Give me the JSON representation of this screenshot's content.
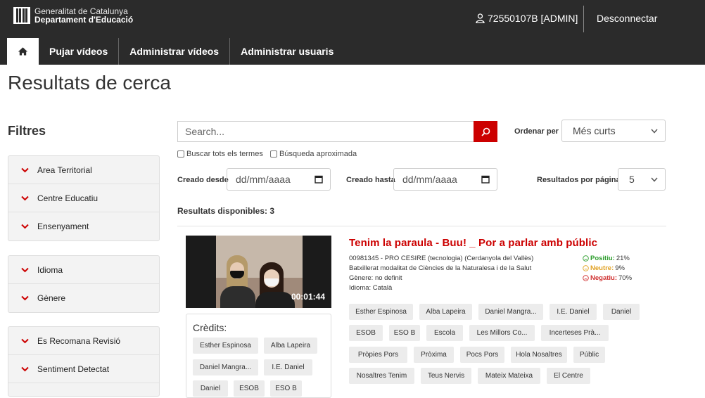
{
  "header": {
    "org_line1": "Generalitat de Catalunya",
    "org_line2": "Departament d'Educació",
    "user": "72550107B [ADMIN]",
    "logout": "Desconnectar",
    "nav": [
      "Pujar vídeos",
      "Administrar vídeos",
      "Administrar usuaris"
    ]
  },
  "page": {
    "title": "Resultats de cerca"
  },
  "filters": {
    "title": "Filtres",
    "group1": [
      "Area Territorial",
      "Centre Educatiu",
      "Ensenyament"
    ],
    "group2": [
      "Idioma",
      "Gènere"
    ],
    "group3": [
      "Es Recomana Revisió",
      "Sentiment Detectat"
    ]
  },
  "search": {
    "placeholder": "Search...",
    "all_terms": "Buscar tots els termes",
    "approx": "Búsqueda aproximada",
    "order_label": "Ordenar per",
    "order_value": "Més curts",
    "from_label": "Creado desde",
    "from_placeholder": "dd/mm/aaaa",
    "to_label": "Creado hasta",
    "to_placeholder": "dd/mm/aaaa",
    "per_page_label": "Resultados por página:",
    "per_page_value": "5",
    "available": "Resultats disponibles: 3"
  },
  "result": {
    "title": "Tenim la paraula - Buu! _ Por a parlar amb públic",
    "duration": "00:01:44",
    "center": "00981345 - PRO CESIRE (tecnologia) (Cerdanyola del Vallès)",
    "course": "Batxillerat modalitat de Ciències de la Naturalesa i de la Salut",
    "genre": "Gènere: no definit",
    "language": "Idioma: Català",
    "sentiment": {
      "positive_label": "Positiu:",
      "positive_value": "21%",
      "positive_color": "#2e9e2e",
      "neutral_label": "Neutre:",
      "neutral_value": "9%",
      "neutral_color": "#e0a020",
      "negative_label": "Negatiu:",
      "negative_value": "70%",
      "negative_color": "#d03030"
    },
    "credits_title": "Crèdits:",
    "credits": [
      "Esther Espinosa",
      "Alba Lapeira",
      "Daniel Mangra...",
      "I.E. Daniel",
      "Daniel",
      "ESOB",
      "ESO B"
    ],
    "tags": [
      "Esther Espinosa",
      "Alba Lapeira",
      "Daniel Mangra...",
      "I.E. Daniel",
      "Daniel",
      "ESOB",
      "ESO B",
      "Escola",
      "Les Millors Co...",
      "Incerteses Prà...",
      "Pròpies Pors",
      "Pròxima",
      "Pocs Pors",
      "Hola Nosaltres",
      "Públic",
      "Nosaltres Tenim",
      "Teus Nervis",
      "Mateix Mateixa",
      "El Centre"
    ]
  }
}
